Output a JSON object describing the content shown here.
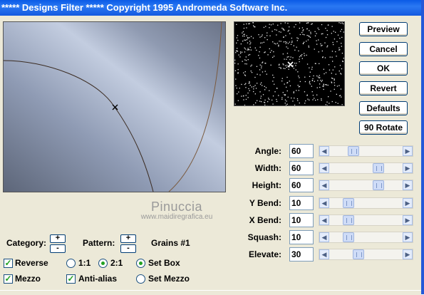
{
  "window": {
    "title": "***** Designs Filter *****  Copyright 1995 Andromeda Software Inc."
  },
  "buttons": {
    "preview": "Preview",
    "cancel": "Cancel",
    "ok": "OK",
    "revert": "Revert",
    "defaults": "Defaults",
    "rotate": "90 Rotate"
  },
  "params": [
    {
      "label": "Angle:",
      "value": "60",
      "level": 0.3
    },
    {
      "label": "Width:",
      "value": "60",
      "level": 0.7
    },
    {
      "label": "Height:",
      "value": "60",
      "level": 0.7
    },
    {
      "label": "Y Bend:",
      "value": "10",
      "level": 0.22
    },
    {
      "label": "X Bend:",
      "value": "10",
      "level": 0.22
    },
    {
      "label": "Squash:",
      "value": "10",
      "level": 0.22
    },
    {
      "label": "Elevate:",
      "value": "30",
      "level": 0.38
    }
  ],
  "category": {
    "label": "Category:",
    "plus": "+",
    "minus": "-"
  },
  "pattern": {
    "label": "Pattern:",
    "plus": "+",
    "minus": "-",
    "value": "Grains #1"
  },
  "options": {
    "reverse": {
      "label": "Reverse",
      "checked": true
    },
    "mezzo": {
      "label": "Mezzo",
      "checked": true
    },
    "anti_alias": {
      "label": "Anti-alias",
      "checked": true
    },
    "ratio_1_1": {
      "label": "1:1",
      "selected": false
    },
    "ratio_2_1": {
      "label": "2:1",
      "selected": true
    },
    "set_box": {
      "label": "Set Box",
      "selected": true
    },
    "set_mezzo": {
      "label": "Set Mezzo",
      "selected": false
    }
  },
  "watermark": {
    "name": "Pinuccia",
    "url": "www.maidiregrafica.eu"
  },
  "colors": {
    "title_bar": "#0a5ae6",
    "dialog_bg": "#ece9d8",
    "check_green": "#21a121"
  }
}
